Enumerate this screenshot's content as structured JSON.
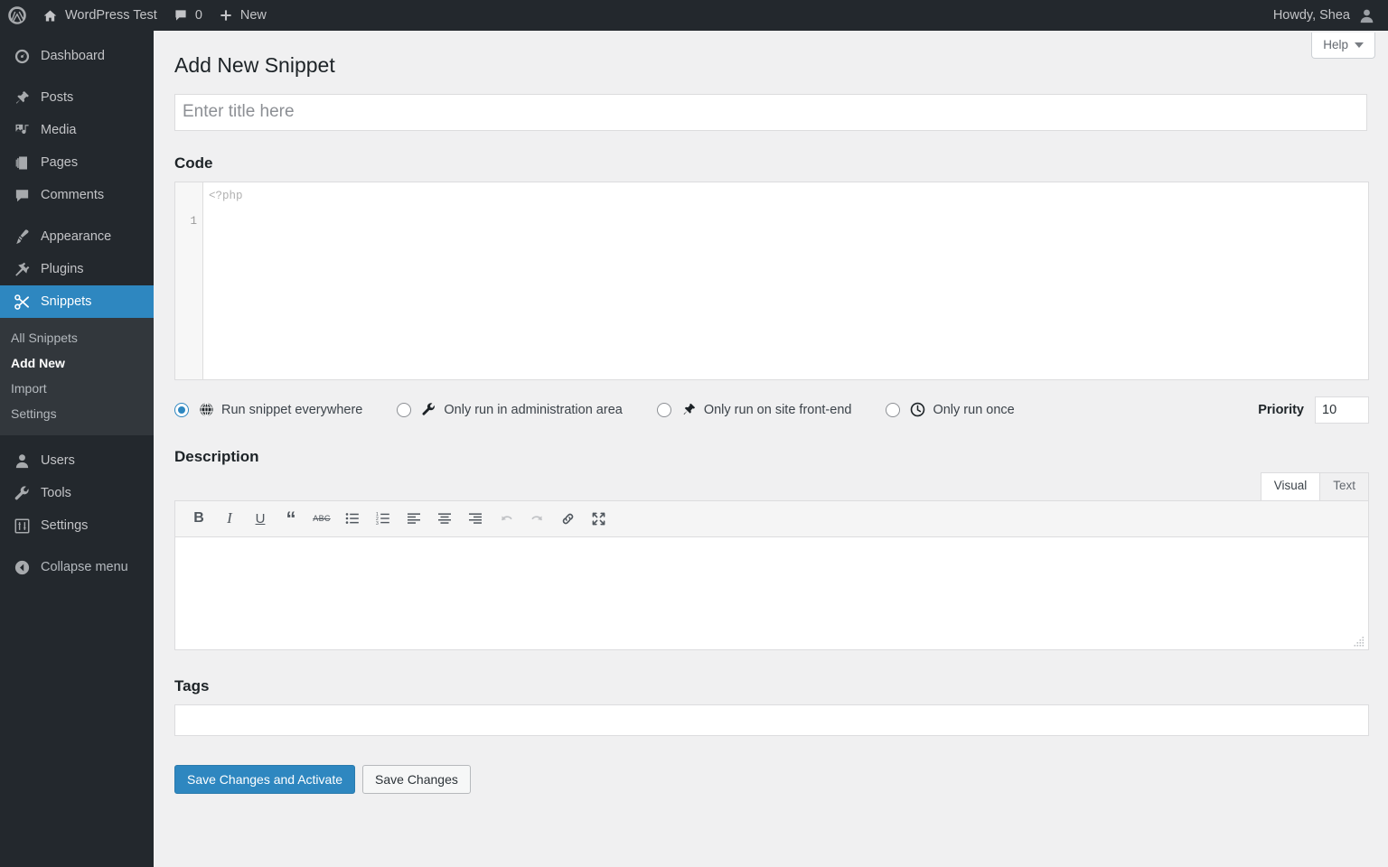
{
  "adminbar": {
    "logo_icon": "wordpress-logo-icon",
    "site_name": "WordPress Test",
    "site_icon": "home-icon",
    "comments_icon": "comment-bubble-icon",
    "comments_count": "0",
    "new_icon": "plus-icon",
    "new_label": "New",
    "howdy": "Howdy, Shea",
    "avatar_icon": "user-avatar-icon"
  },
  "sidebar": {
    "items": [
      {
        "label": "Dashboard",
        "icon": "dashboard-gauge-icon",
        "current": false
      },
      {
        "label": "Posts",
        "icon": "pin-icon",
        "current": false
      },
      {
        "label": "Media",
        "icon": "media-icon",
        "current": false
      },
      {
        "label": "Pages",
        "icon": "pages-icon",
        "current": false
      },
      {
        "label": "Comments",
        "icon": "comment-bubble-icon",
        "current": false
      },
      {
        "label": "Appearance",
        "icon": "paintbrush-icon",
        "current": false
      },
      {
        "label": "Plugins",
        "icon": "plug-icon",
        "current": false
      },
      {
        "label": "Snippets",
        "icon": "scissors-icon",
        "current": true
      },
      {
        "label": "Users",
        "icon": "user-icon",
        "current": false
      },
      {
        "label": "Tools",
        "icon": "wrench-icon",
        "current": false
      },
      {
        "label": "Settings",
        "icon": "sliders-icon",
        "current": false
      }
    ],
    "submenu": [
      {
        "label": "All Snippets",
        "current": false
      },
      {
        "label": "Add New",
        "current": true
      },
      {
        "label": "Import",
        "current": false
      },
      {
        "label": "Settings",
        "current": false
      }
    ],
    "collapse_label": "Collapse menu",
    "collapse_icon": "collapse-arrow-icon",
    "highlight_color": "#2e87c0"
  },
  "help": {
    "label": "Help",
    "caret_icon": "chevron-down-icon"
  },
  "page": {
    "title": "Add New Snippet"
  },
  "title_field": {
    "value": "",
    "placeholder": "Enter title here"
  },
  "code": {
    "label": "Code",
    "line_number": "1",
    "placeholder": "<?php",
    "value": ""
  },
  "scope": {
    "options": [
      {
        "label": "Run snippet everywhere",
        "icon": "globe-icon",
        "checked": true
      },
      {
        "label": "Only run in administration area",
        "icon": "wrench-icon",
        "checked": false
      },
      {
        "label": "Only run on site front-end",
        "icon": "pin-icon",
        "checked": false
      },
      {
        "label": "Only run once",
        "icon": "clock-icon",
        "checked": false
      }
    ],
    "priority_label": "Priority",
    "priority_value": "10"
  },
  "description": {
    "label": "Description",
    "tabs": [
      {
        "label": "Visual",
        "active": true
      },
      {
        "label": "Text",
        "active": false
      }
    ],
    "toolbar": [
      {
        "name": "bold-icon",
        "glyph": "B",
        "disabled": false
      },
      {
        "name": "italic-icon",
        "glyph": "I",
        "disabled": false
      },
      {
        "name": "underline-icon",
        "glyph": "U",
        "disabled": false
      },
      {
        "name": "blockquote-icon",
        "glyph": "“",
        "disabled": false
      },
      {
        "name": "strikethrough-icon",
        "glyph": "ABC",
        "disabled": false
      },
      {
        "name": "bulleted-list-icon",
        "glyph": "",
        "disabled": false
      },
      {
        "name": "numbered-list-icon",
        "glyph": "",
        "disabled": false
      },
      {
        "name": "align-left-icon",
        "glyph": "",
        "disabled": false
      },
      {
        "name": "align-center-icon",
        "glyph": "",
        "disabled": false
      },
      {
        "name": "align-right-icon",
        "glyph": "",
        "disabled": false
      },
      {
        "name": "undo-icon",
        "glyph": "",
        "disabled": true
      },
      {
        "name": "redo-icon",
        "glyph": "",
        "disabled": true
      },
      {
        "name": "link-icon",
        "glyph": "",
        "disabled": false
      },
      {
        "name": "fullscreen-icon",
        "glyph": "",
        "disabled": false
      }
    ],
    "body_value": "",
    "resize_icon": "resize-grip-icon"
  },
  "tags": {
    "label": "Tags",
    "value": ""
  },
  "buttons": {
    "primary_label": "Save Changes and Activate",
    "secondary_label": "Save Changes",
    "primary_color": "#2e87c0"
  }
}
